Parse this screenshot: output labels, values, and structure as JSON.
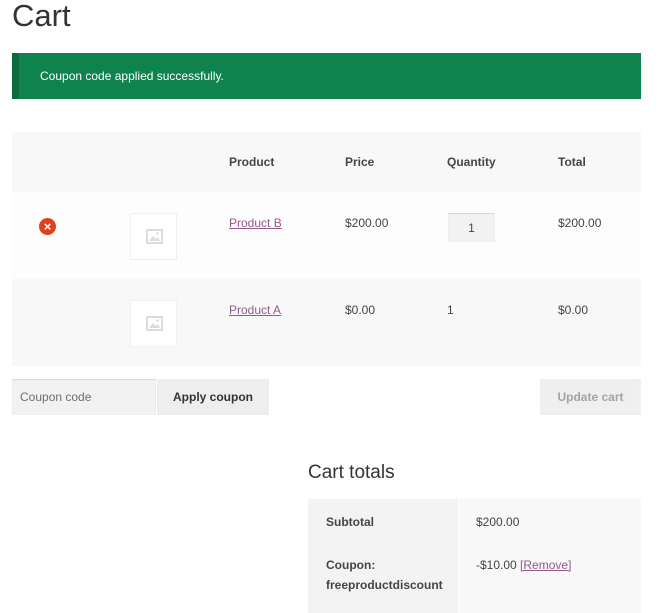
{
  "page": {
    "title": "Cart"
  },
  "notice": {
    "message": "Coupon code applied successfully."
  },
  "cart": {
    "headers": {
      "product": "Product",
      "price": "Price",
      "quantity": "Quantity",
      "total": "Total"
    },
    "rows": [
      {
        "name": "Product B",
        "price": "$200.00",
        "quantity": "1",
        "total": "$200.00",
        "removable": true,
        "qty_editable": true
      },
      {
        "name": "Product A",
        "price": "$0.00",
        "quantity": "1",
        "total": "$0.00",
        "removable": false,
        "qty_editable": false
      }
    ]
  },
  "actions": {
    "coupon_placeholder": "Coupon code",
    "apply_label": "Apply coupon",
    "update_label": "Update cart"
  },
  "totals": {
    "title": "Cart totals",
    "subtotal_label": "Subtotal",
    "subtotal_value": "$200.00",
    "coupon_label_line1": "Coupon:",
    "coupon_label_line2": "freeproductdiscount",
    "coupon_value": "-$10.00",
    "remove_label": "[Remove]"
  },
  "colors": {
    "notice_bg": "#0f834d",
    "link": "#96588a",
    "remove_icon": "#e2401c"
  },
  "icons": {
    "remove": "remove-circle-icon",
    "placeholder": "image-placeholder-icon"
  }
}
